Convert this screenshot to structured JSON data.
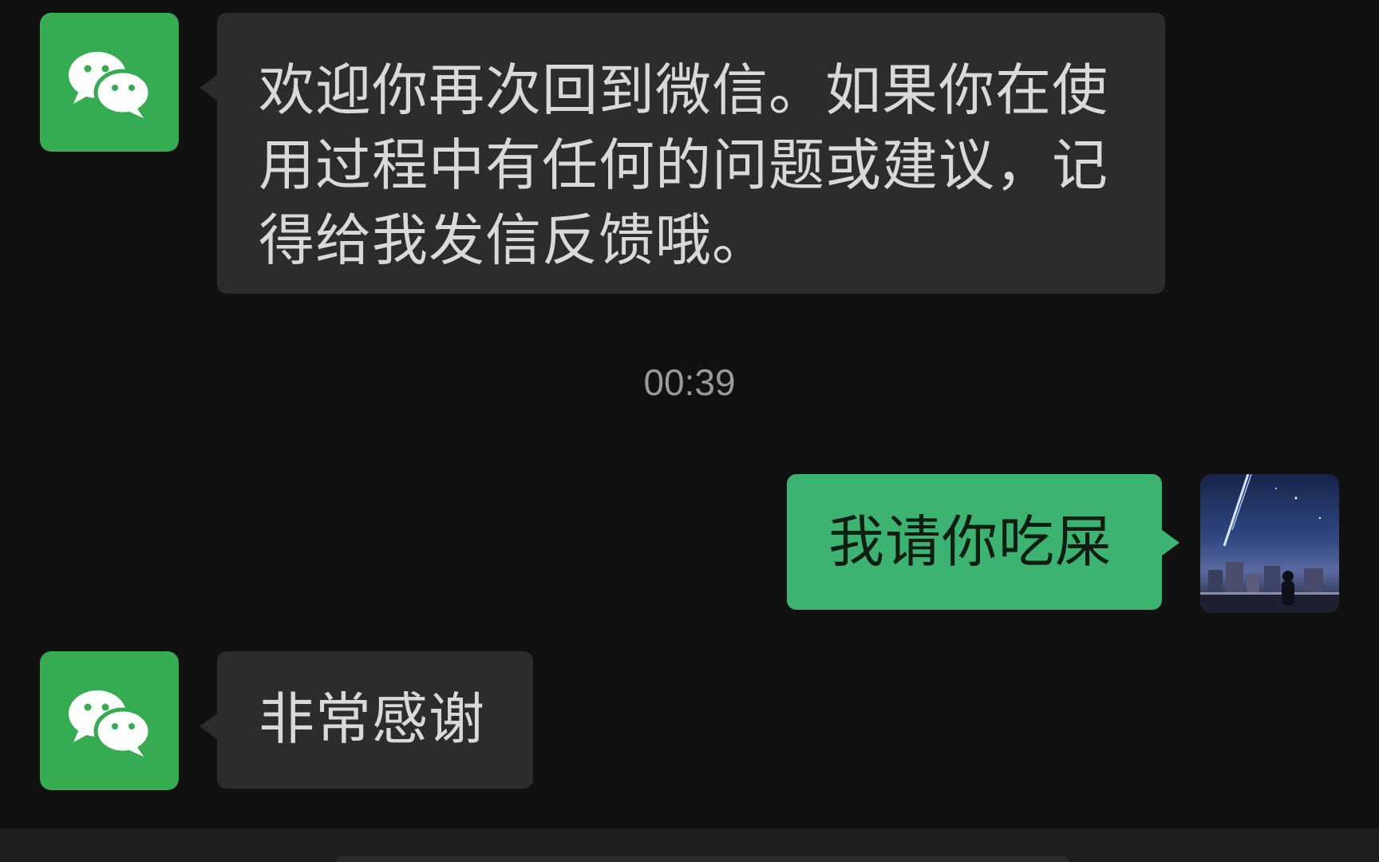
{
  "messages": [
    {
      "sender": "WeChat",
      "side": "left",
      "text": "欢迎你再次回到微信。如果你在使用过程中有任何的问题或建议，记得给我发信反馈哦。"
    },
    {
      "sender": "me",
      "side": "right",
      "text": "我请你吃屎"
    },
    {
      "sender": "WeChat",
      "side": "left",
      "text": "非常感谢"
    }
  ],
  "timestamp": "00:39",
  "icons": {
    "wechat_avatar": "wechat-logo-icon",
    "user_avatar": "user-avatar-image"
  },
  "colors": {
    "background": "#111111",
    "incoming_bubble": "#2c2c2c",
    "outgoing_bubble": "#3cb371",
    "wechat_green": "#35ab52",
    "timestamp_text": "#9a9a9a"
  }
}
